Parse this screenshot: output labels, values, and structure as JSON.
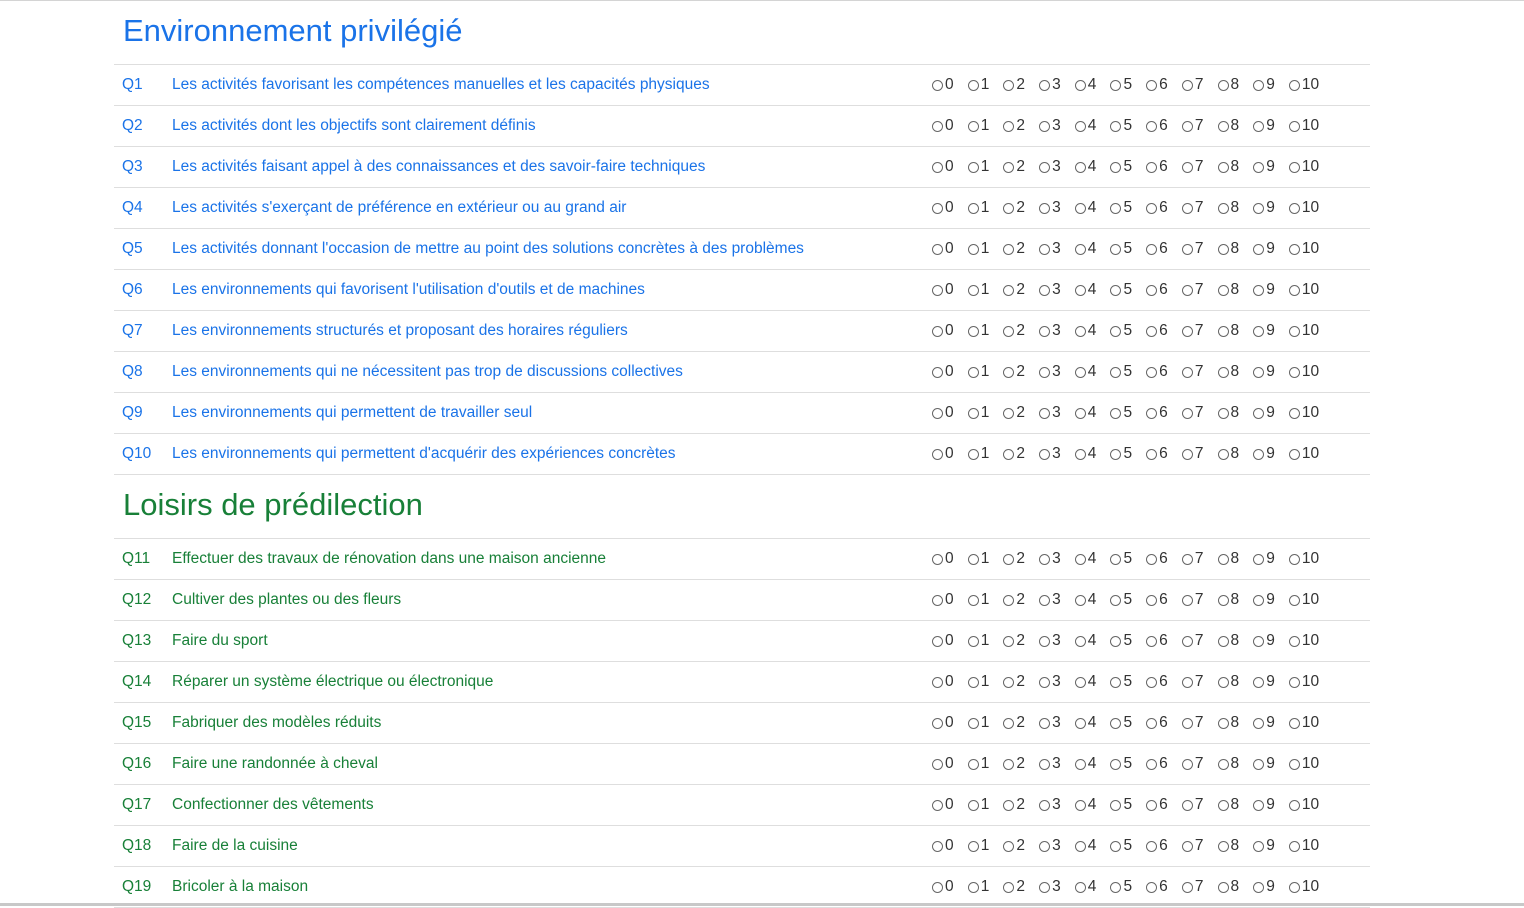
{
  "scale_labels": [
    "0",
    "1",
    "2",
    "3",
    "4",
    "5",
    "6",
    "7",
    "8",
    "9",
    "10"
  ],
  "sections": [
    {
      "title": "Environnement privilégié",
      "color": "#1a73e8",
      "questions": [
        {
          "num": "Q1",
          "text": "Les activités favorisant les compétences manuelles et les capacités physiques"
        },
        {
          "num": "Q2",
          "text": "Les activités dont les objectifs sont clairement définis"
        },
        {
          "num": "Q3",
          "text": "Les activités faisant appel à des connaissances et des savoir-faire techniques"
        },
        {
          "num": "Q4",
          "text": "Les activités s'exerçant de préférence en extérieur ou au grand air"
        },
        {
          "num": "Q5",
          "text": "Les activités donnant l'occasion de mettre au point des solutions concrètes à des problèmes"
        },
        {
          "num": "Q6",
          "text": "Les environnements qui favorisent l'utilisation d'outils et de machines"
        },
        {
          "num": "Q7",
          "text": "Les environnements structurés et proposant des horaires réguliers"
        },
        {
          "num": "Q8",
          "text": "Les environnements qui ne nécessitent pas trop de discussions collectives"
        },
        {
          "num": "Q9",
          "text": "Les environnements qui permettent de travailler seul"
        },
        {
          "num": "Q10",
          "text": "Les environnements qui permettent d'acquérir des expériences concrètes"
        }
      ]
    },
    {
      "title": "Loisirs de prédilection",
      "color": "#188038",
      "questions": [
        {
          "num": "Q11",
          "text": "Effectuer des travaux de rénovation dans une maison ancienne"
        },
        {
          "num": "Q12",
          "text": "Cultiver des plantes ou des fleurs"
        },
        {
          "num": "Q13",
          "text": "Faire du sport"
        },
        {
          "num": "Q14",
          "text": "Réparer un système électrique ou électronique"
        },
        {
          "num": "Q15",
          "text": "Fabriquer des modèles réduits"
        },
        {
          "num": "Q16",
          "text": "Faire une randonnée à cheval"
        },
        {
          "num": "Q17",
          "text": "Confectionner des vêtements"
        },
        {
          "num": "Q18",
          "text": "Faire de la cuisine"
        },
        {
          "num": "Q19",
          "text": "Bricoler à la maison"
        }
      ]
    }
  ]
}
